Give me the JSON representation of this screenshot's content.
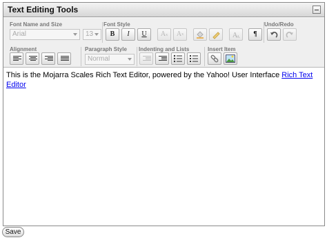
{
  "editor": {
    "title": "Text Editing Tools"
  },
  "toolbar": {
    "groups": {
      "font_name_size": "Font Name and Size",
      "font_style": "Font Style",
      "undo_redo": "Undo/Redo",
      "alignment": "Alignment",
      "paragraph_style": "Paragraph Style",
      "indenting_lists": "Indenting and Lists",
      "insert_item": "Insert Item"
    },
    "font_name": "Arial",
    "font_size": "13",
    "paragraph_style": "Normal",
    "bold_label": "B",
    "italic_label": "I",
    "underline_label": "U",
    "subscript_label": "A",
    "superscript_label": "A"
  },
  "content": {
    "text": "This is the Mojarra Scales Rich Text Editor, powered by the Yahoo! User Interface ",
    "link_text": "Rich Text Editor"
  },
  "footer": {
    "save_label": "Save"
  },
  "colors": {
    "link": "#0000ee",
    "toolbar_bg": "#efefef"
  }
}
